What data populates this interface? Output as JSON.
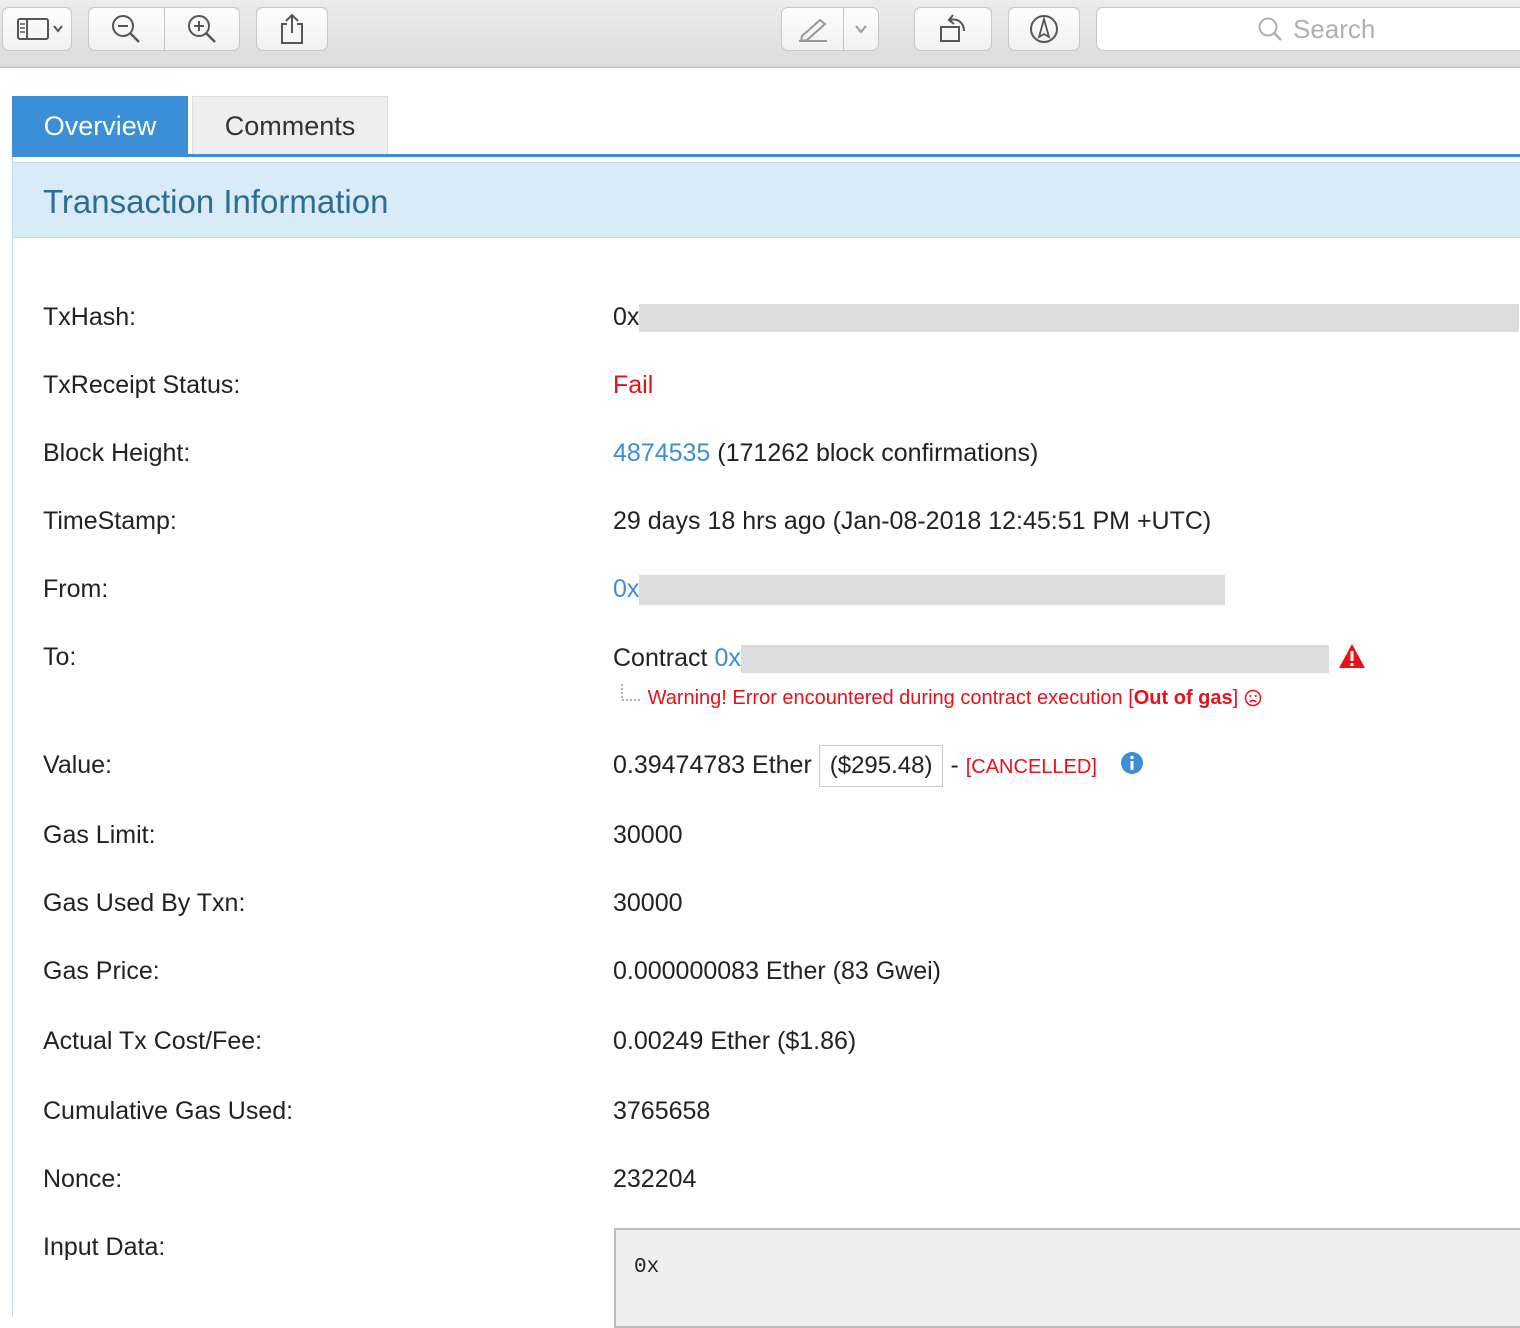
{
  "toolbar": {
    "search_placeholder": "Search"
  },
  "tabs": [
    {
      "label": "Overview",
      "active": true
    },
    {
      "label": "Comments",
      "active": false
    }
  ],
  "panel": {
    "title": "Transaction Information"
  },
  "tx": {
    "txhash_label": "TxHash:",
    "txhash_value": "0x",
    "status_label": "TxReceipt Status:",
    "status_value": "Fail",
    "block_label": "Block Height:",
    "block_number": "4874535",
    "block_confirmations": "(171262 block confirmations)",
    "timestamp_label": "TimeStamp:",
    "timestamp_value": "29 days 18 hrs ago (Jan-08-2018 12:45:51 PM +UTC)",
    "from_label": "From:",
    "from_value": "0x",
    "to_label": "To:",
    "to_prefix": "Contract",
    "to_value": "0x",
    "warning_text": "Warning! Error encountered during contract execution [",
    "warning_bold": "Out of gas",
    "warning_end": "]",
    "value_label": "Value:",
    "value_ether": "0.39474783 Ether",
    "value_usd": "($295.48)",
    "value_dash": "-",
    "value_cancelled": "[CANCELLED]",
    "gas_limit_label": "Gas Limit:",
    "gas_limit_value": "30000",
    "gas_used_label": "Gas Used By Txn:",
    "gas_used_value": "30000",
    "gas_price_label": "Gas Price:",
    "gas_price_value": "0.000000083 Ether (83 Gwei)",
    "fee_label": "Actual Tx Cost/Fee:",
    "fee_value": "0.00249 Ether ($1.86)",
    "cumulative_label": "Cumulative Gas Used:",
    "cumulative_value": "3765658",
    "nonce_label": "Nonce:",
    "nonce_value": "232204",
    "input_label": "Input Data:",
    "input_value": "0x"
  },
  "colors": {
    "accent": "#3a8fd6",
    "error": "#e8101a",
    "header_bg": "#d8ebf6",
    "title": "#2a6e93"
  }
}
